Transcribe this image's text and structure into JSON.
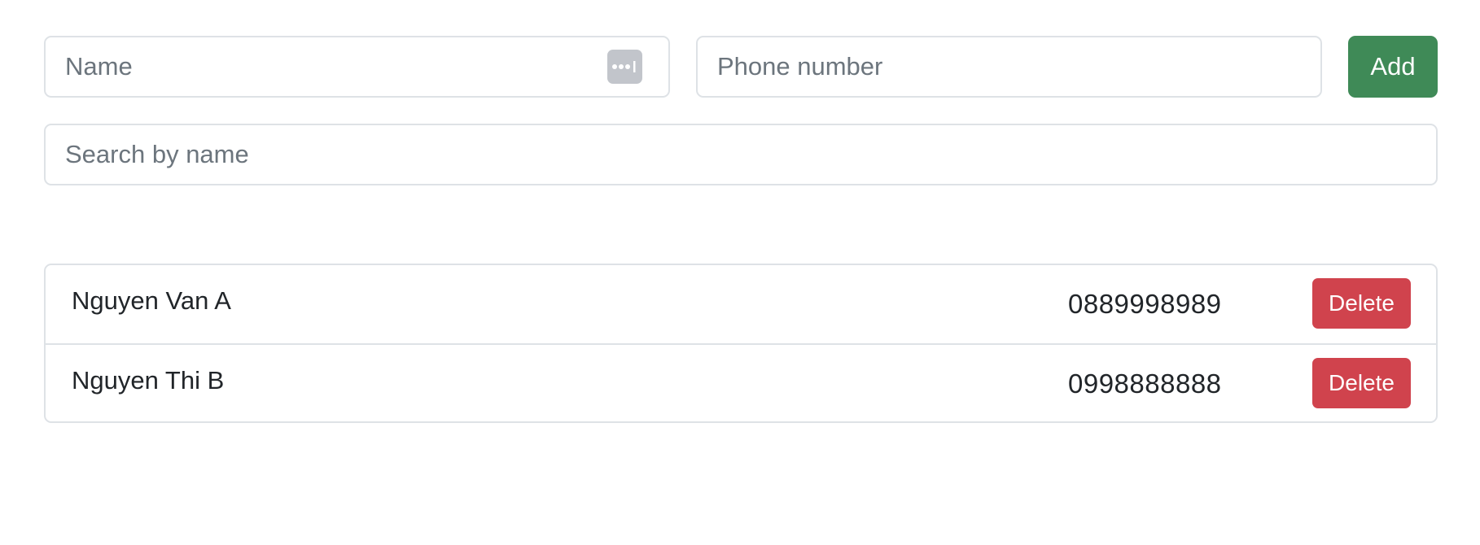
{
  "form": {
    "name_placeholder": "Name",
    "name_value": "",
    "phone_placeholder": "Phone number",
    "phone_value": "",
    "add_label": "Add",
    "add_color": "#3f8a57"
  },
  "search": {
    "placeholder": "Search by name",
    "value": ""
  },
  "contacts": [
    {
      "name": "Nguyen Van A",
      "phone": "0889998989",
      "delete_label": "Delete"
    },
    {
      "name": "Nguyen Thi B",
      "phone": "0998888888",
      "delete_label": "Delete"
    }
  ],
  "colors": {
    "add_button": "#3f8a57",
    "delete_button": "#d0434d",
    "border": "#dee2e6",
    "placeholder_text": "#6c757d"
  },
  "icons": {
    "autofill": "password-autofill-icon"
  }
}
